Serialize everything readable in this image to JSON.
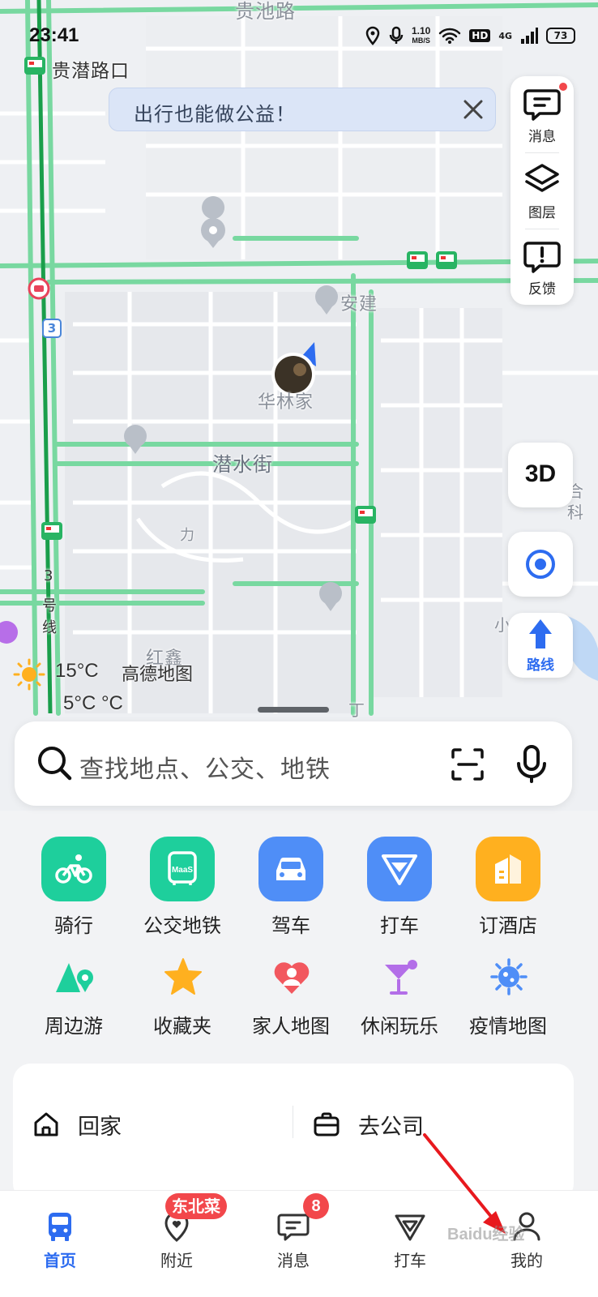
{
  "status_bar": {
    "time": "23:41",
    "speed_value": "1.10",
    "speed_unit": "MB/S",
    "hd_badge": "HD",
    "network": "4G",
    "battery": "73"
  },
  "map": {
    "labels": {
      "top_road": "贵池路",
      "bus_stop_name": "贵潜路口",
      "street_qianshui": "潜水街",
      "community_huaxinjia": "华林家",
      "anjian": "安建",
      "hongxin": "红鑫",
      "line3_a": "3",
      "line3_b": "号",
      "line3_c": "线",
      "line3_badge": "3",
      "he": "合",
      "ke": "科",
      "xiao": "小",
      "ding": "丁",
      "li": "力"
    },
    "weather": {
      "temp_high": "15°C",
      "temp_low": "5°C °C",
      "brand": "高德地图"
    }
  },
  "banner": {
    "text": "出行也能做公益！"
  },
  "tool_panel": {
    "message": "消息",
    "layers": "图层",
    "feedback": "反馈"
  },
  "map_controls": {
    "view_3d": "3D",
    "route": "路线"
  },
  "search": {
    "placeholder": "查找地点、公交、地铁"
  },
  "shortcuts": [
    {
      "label": "骑行",
      "icon": "bike-icon",
      "color": "#1ecf9c"
    },
    {
      "label": "公交地铁",
      "icon": "bus-icon",
      "color": "#1ecf9c"
    },
    {
      "label": "驾车",
      "icon": "car-icon",
      "color": "#4f8ef7"
    },
    {
      "label": "打车",
      "icon": "taxi-icon",
      "color": "#4f8ef7"
    },
    {
      "label": "订酒店",
      "icon": "hotel-icon",
      "color": "#ffb01f"
    },
    {
      "label": "周边游",
      "icon": "mountain-pin-icon",
      "color": "#1ecf9c"
    },
    {
      "label": "收藏夹",
      "icon": "star-icon",
      "color": "#ffb01f"
    },
    {
      "label": "家人地图",
      "icon": "heart-person-icon",
      "color": "#f2575e"
    },
    {
      "label": "休闲玩乐",
      "icon": "cocktail-icon",
      "color": "#b36ee8"
    },
    {
      "label": "疫情地图",
      "icon": "virus-icon",
      "color": "#4f8ef7"
    }
  ],
  "commute": {
    "home": "回家",
    "work": "去公司"
  },
  "tabs": [
    {
      "label": "首页",
      "icon": "bus-tab-icon",
      "active": true
    },
    {
      "label": "附近",
      "icon": "location-heart-icon",
      "badge": "东北菜"
    },
    {
      "label": "消息",
      "icon": "chat-icon",
      "badge": "8"
    },
    {
      "label": "打车",
      "icon": "taxi-tab-icon"
    },
    {
      "label": "我的",
      "icon": "person-icon"
    }
  ],
  "colors": {
    "accent": "#2d6cf0",
    "road_green": "#6fd49a",
    "badge_red": "#f2474b",
    "annotation_arrow": "#e8191e"
  },
  "watermark": "Baidu经验"
}
